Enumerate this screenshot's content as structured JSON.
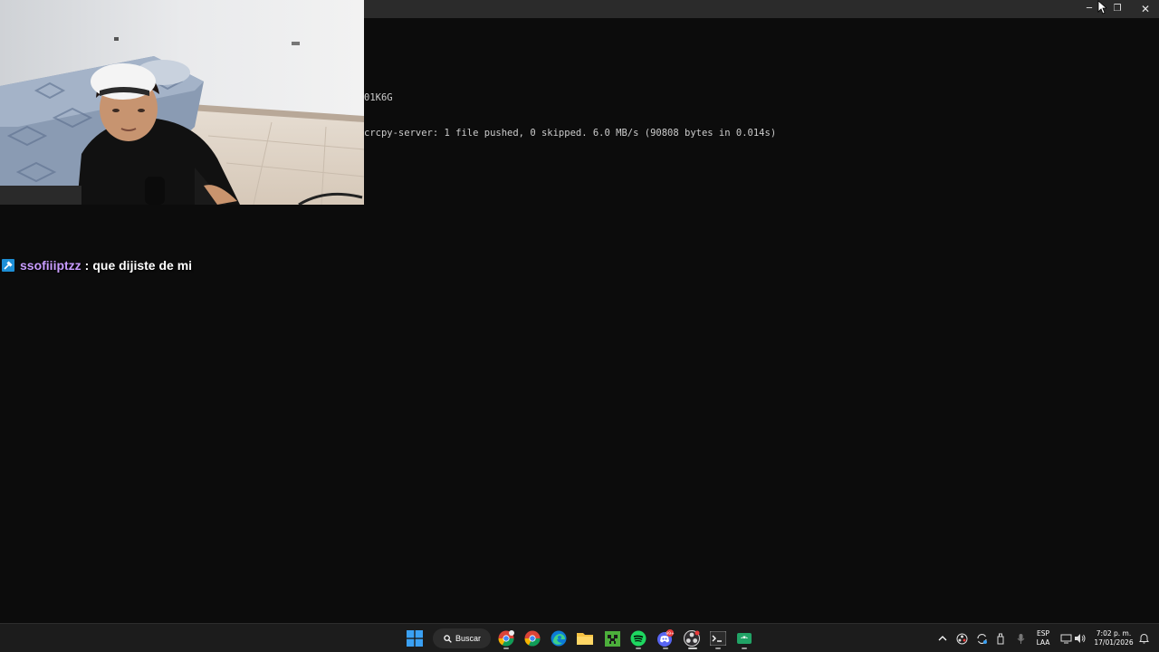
{
  "window": {
    "controls": {
      "minimize": "─",
      "maximize": "❐",
      "close": "✕"
    }
  },
  "terminal": {
    "lines": [
      "01K6G",
      "crcpy-server: 1 file pushed, 0 skipped. 6.0 MB/s (90808 bytes in 0.014s)"
    ]
  },
  "webcam": {
    "icon": "webcam-feed"
  },
  "chat": {
    "username": "ssofiiiptzz",
    "separator": ":",
    "message": "que dijiste de mi",
    "username_color": "#c89cff"
  },
  "taskbar": {
    "search_label": "Buscar",
    "pinned": [
      "start-icon",
      "chrome-icon",
      "chrome-icon",
      "edge-icon",
      "file-explorer-icon",
      "minecraft-icon",
      "spotify-icon",
      "discord-icon",
      "obs-icon",
      "terminal-icon",
      "android-icon"
    ],
    "discord_badge": "99+"
  },
  "tray": {
    "language_top": "ESP",
    "language_bottom": "LAA",
    "time": "7:02 p. m.",
    "date": "17/01/2026"
  }
}
